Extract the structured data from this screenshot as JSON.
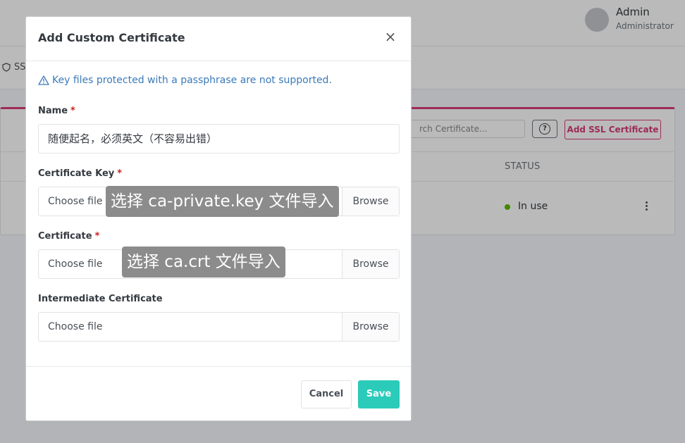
{
  "header": {
    "user_name": "Admin",
    "user_role": "Administrator"
  },
  "nav": {
    "partial_label": "SS"
  },
  "table": {
    "search_placeholder": "rch Certificate...",
    "add_button": "Add SSL Certificate",
    "status_header": "STATUS",
    "row_status": "In use"
  },
  "modal": {
    "title": "Add Custom Certificate",
    "close_symbol": "×",
    "alert": "Key files protected with a passphrase are not supported.",
    "name_label": "Name",
    "name_value": "随便起名，必须英文（不容易出错）",
    "cert_key_label": "Certificate Key",
    "certificate_label": "Certificate",
    "intermediate_label": "Intermediate Certificate",
    "required_mark": "*",
    "choose_file": "Choose file",
    "browse": "Browse",
    "cancel": "Cancel",
    "save": "Save"
  },
  "annotations": {
    "key_tip": "选择 ca-private.key 文件导入",
    "cert_tip": "选择 ca.crt 文件导入"
  },
  "colors": {
    "accent_pink": "#d63c78",
    "save_teal": "#2bcbba",
    "alert_blue": "#3b7ab8",
    "status_green": "#5eba00",
    "required_red": "#cd201f"
  }
}
